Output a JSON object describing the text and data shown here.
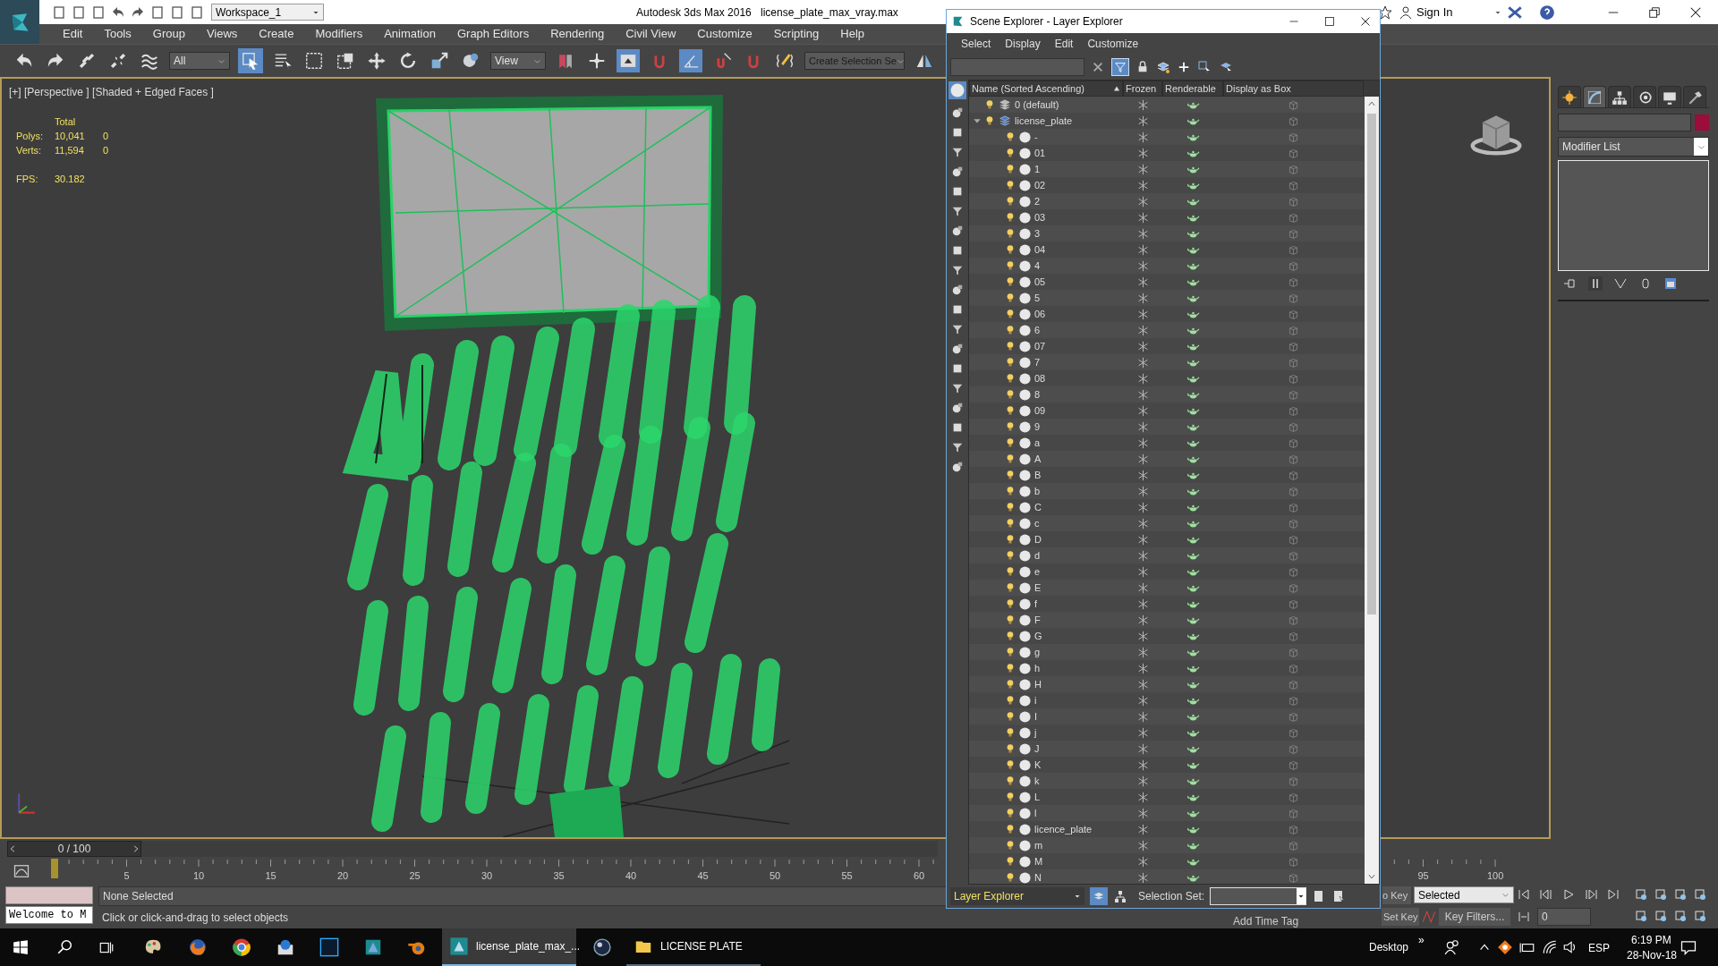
{
  "app": {
    "workspace": "Workspace_1",
    "title": "Autodesk 3ds Max 2016",
    "file": "license_plate_max_vray.max",
    "sign_in": "Sign In"
  },
  "menu": [
    "Edit",
    "Tools",
    "Group",
    "Views",
    "Create",
    "Modifiers",
    "Animation",
    "Graph Editors",
    "Rendering",
    "Civil View",
    "Customize",
    "Scripting",
    "Help"
  ],
  "toolbar": {
    "filter": "All",
    "ref_coord": "View",
    "selection_set": "Create Selection Se"
  },
  "viewport": {
    "label": "[+] [Perspective ] [Shaded + Edged Faces ]",
    "stats_heading": "Total",
    "stats": [
      {
        "label": "Polys:",
        "total": "10,041",
        "selected": "0"
      },
      {
        "label": "Verts:",
        "total": "11,594",
        "selected": "0"
      }
    ],
    "fps_label": "FPS:",
    "fps": "30.182"
  },
  "command_panel": {
    "tabs": [
      {
        "kind": "create",
        "selected": false
      },
      {
        "kind": "modify",
        "selected": true
      },
      {
        "kind": "hierarchy",
        "selected": false
      },
      {
        "kind": "motion",
        "selected": false
      },
      {
        "kind": "display",
        "selected": false
      },
      {
        "kind": "utilities",
        "selected": false
      }
    ],
    "modifier_list": "Modifier List"
  },
  "scene_explorer": {
    "title": "Scene Explorer - Layer Explorer",
    "menu": [
      "Select",
      "Display",
      "Edit",
      "Customize"
    ],
    "columns": [
      "Name (Sorted Ascending)",
      "Frozen",
      "Renderable",
      "Display as Box"
    ],
    "layers": [
      {
        "name": "0 (default)",
        "expanded": false
      },
      {
        "name": "license_plate",
        "expanded": true,
        "children": [
          {
            "name": "-"
          },
          {
            "name": "01"
          },
          {
            "name": "1"
          },
          {
            "name": "02"
          },
          {
            "name": "2"
          },
          {
            "name": "03"
          },
          {
            "name": "3"
          },
          {
            "name": "04"
          },
          {
            "name": "4"
          },
          {
            "name": "05"
          },
          {
            "name": "5"
          },
          {
            "name": "06"
          },
          {
            "name": "6"
          },
          {
            "name": "07"
          },
          {
            "name": "7"
          },
          {
            "name": "08"
          },
          {
            "name": "8"
          },
          {
            "name": "09"
          },
          {
            "name": "9"
          },
          {
            "name": "a"
          },
          {
            "name": "A"
          },
          {
            "name": "B"
          },
          {
            "name": "b"
          },
          {
            "name": "C"
          },
          {
            "name": "c"
          },
          {
            "name": "D"
          },
          {
            "name": "d"
          },
          {
            "name": "e"
          },
          {
            "name": "E"
          },
          {
            "name": "f"
          },
          {
            "name": "F"
          },
          {
            "name": "G"
          },
          {
            "name": "g"
          },
          {
            "name": "h"
          },
          {
            "name": "H"
          },
          {
            "name": "i"
          },
          {
            "name": "I"
          },
          {
            "name": "j"
          },
          {
            "name": "J"
          },
          {
            "name": "K"
          },
          {
            "name": "k"
          },
          {
            "name": "L"
          },
          {
            "name": "l"
          },
          {
            "name": "licence_plate"
          },
          {
            "name": "m"
          },
          {
            "name": "M"
          },
          {
            "name": "N"
          }
        ]
      }
    ],
    "explorer_type": "Layer Explorer",
    "selection_set_label": "Selection Set:"
  },
  "timeline": {
    "position": "0 / 100",
    "level": 0,
    "ticks": [
      "5",
      "10",
      "15",
      "20",
      "25",
      "30",
      "35",
      "40",
      "45",
      "50",
      "55",
      "60",
      "95",
      "100"
    ]
  },
  "status": {
    "listener": "Welcome to M",
    "selection": "None Selected",
    "prompt": "Click or click-and-drag to select objects",
    "add_time_tag": "Add Time Tag",
    "auto_key": "o Key",
    "set_key": "Set Key",
    "key_mode": "Selected",
    "key_filters": "Key Filters...",
    "frame": "0"
  },
  "taskbar": {
    "apps": [
      {
        "label": "license_plate_max_...",
        "selected": true
      },
      {
        "label": "LICENSE PLATE",
        "selected": false
      }
    ],
    "desktop": "Desktop",
    "chevron": "»",
    "language": "ESP",
    "time": "6:19 PM",
    "date": "28-Nov-18"
  }
}
